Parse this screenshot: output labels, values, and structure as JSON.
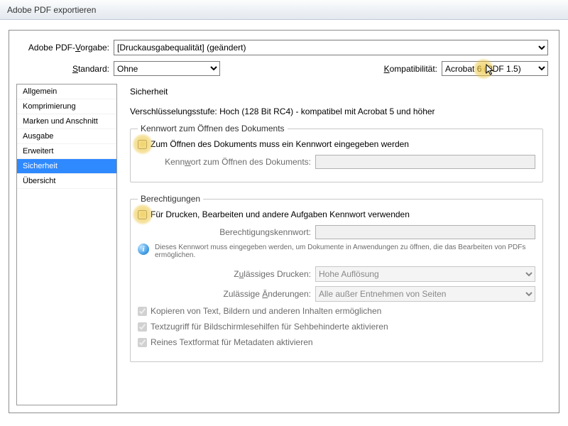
{
  "window": {
    "title": "Adobe PDF exportieren"
  },
  "header": {
    "preset_label": "Adobe PDF-Vorgabe:",
    "preset_underline_first_letter": "V",
    "preset_value": "[Druckausgabequalität] (geändert)",
    "standard_label_pre": "S",
    "standard_label": "tandard:",
    "standard_value": "Ohne",
    "compat_label_pre": "K",
    "compat_label": "ompatibilität:",
    "compat_value": "Acrobat 6 (PDF 1.5)"
  },
  "sidebar": {
    "items": [
      {
        "label": "Allgemein"
      },
      {
        "label": "Komprimierung"
      },
      {
        "label": "Marken und Anschnitt"
      },
      {
        "label": "Ausgabe"
      },
      {
        "label": "Erweitert"
      },
      {
        "label": "Sicherheit"
      },
      {
        "label": "Übersicht"
      }
    ],
    "selected_index": 5
  },
  "security": {
    "title": "Sicherheit",
    "encryption_level": "Verschlüsselungsstufe: Hoch (128 Bit RC4) - kompatibel mit Acrobat 5 und höher",
    "open_group": {
      "legend": "Kennwort zum Öffnen des Dokuments",
      "checkbox_label": "Zum Öffnen des Dokuments muss ein Kennwort eingegeben werden",
      "password_prefix": "Kenn",
      "password_u": "w",
      "password_suffix": "ort zum Öffnen des Dokuments:",
      "password_value": "",
      "checked": false
    },
    "perm_group": {
      "legend": "Berechtigungen",
      "checkbox_label": "Für Drucken, Bearbeiten und andere Aufgaben Kennwort verwenden",
      "checked": false,
      "perm_pw_label": "Berechtigungskennwort:",
      "perm_pw_value": "",
      "info_text": "Dieses Kennwort muss eingegeben werden, um Dokumente in Anwendungen zu öffnen, die das Bearbeiten von PDFs ermöglichen.",
      "print_prefix": "Z",
      "print_u": "u",
      "print_suffix": "lässiges Drucken:",
      "print_value": "Hohe Auflösung",
      "changes_prefix": "Zulässige ",
      "changes_u": "Ä",
      "changes_suffix": "nderungen:",
      "changes_value": "Alle außer Entnehmen von Seiten",
      "limit_checks": [
        {
          "label": "Kopieren von Text, Bildern und anderen Inhalten ermöglichen",
          "checked": true
        },
        {
          "label": "Textzugriff für Bildschirmlesehilfen für Sehbehinderte aktivieren",
          "checked": true
        },
        {
          "label": "Reines Textformat für Metadaten aktivieren",
          "checked": true
        }
      ]
    }
  }
}
